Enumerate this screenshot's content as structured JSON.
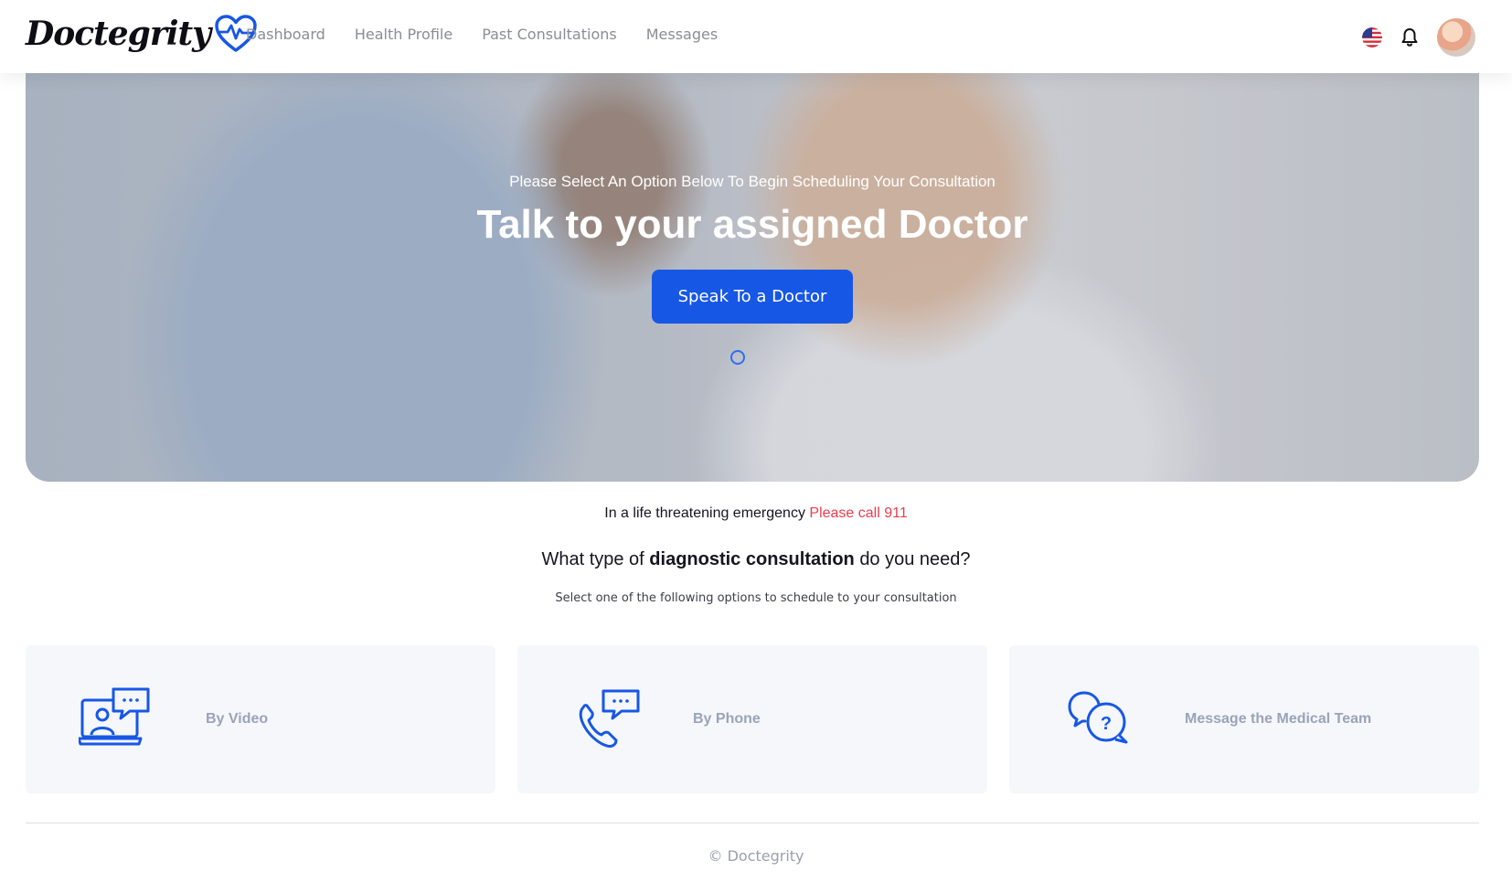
{
  "header": {
    "logo_text": "Doctegrity",
    "nav": [
      "Dashboard",
      "Health Profile",
      "Past Consultations",
      "Messages"
    ],
    "icons": {
      "language": "us-flag-icon",
      "notifications": "bell-icon",
      "profile": "avatar"
    }
  },
  "hero": {
    "subtitle": "Please Select An Option Below To Begin Scheduling Your Consultation",
    "title": "Talk to your assigned Doctor",
    "button": "Speak To a Doctor"
  },
  "emergency": {
    "text": "In a life threatening emergency",
    "call": "Please call 911"
  },
  "question": {
    "prefix": "What type of",
    "emphasis": "diagnostic consultation",
    "suffix": "do you need?",
    "hint": "Select one of the following options to schedule to your consultation"
  },
  "options": [
    {
      "label": "By Video",
      "icon": "video-consult-icon"
    },
    {
      "label": "By Phone",
      "icon": "phone-consult-icon"
    },
    {
      "label": "Message the Medical Team",
      "icon": "message-question-icon"
    }
  ],
  "footer": {
    "text": "© Doctegrity"
  },
  "colors": {
    "brand": "#1757e6",
    "emergency": "#ee3b4e",
    "card_bg": "#f5f7fb"
  }
}
